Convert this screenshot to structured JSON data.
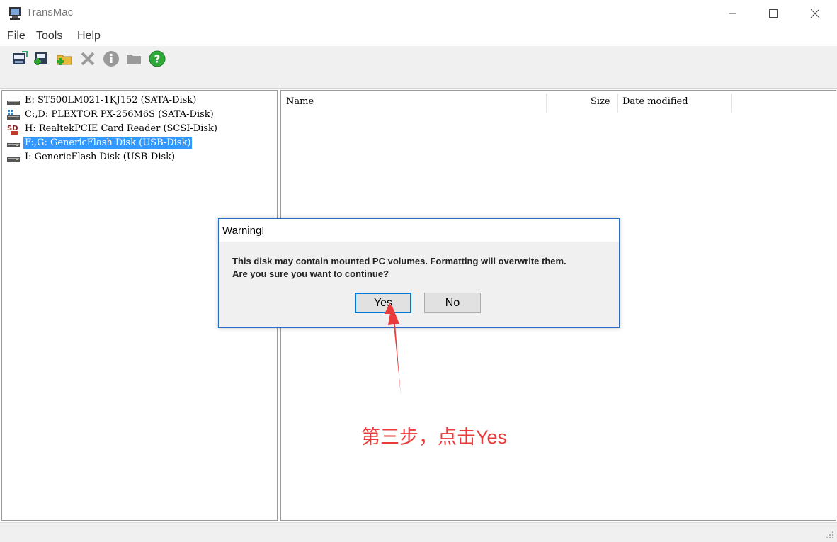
{
  "window": {
    "title": "TransMac",
    "minimize_icon": "minimize-icon",
    "maximize_icon": "maximize-icon",
    "close_icon": "close-icon"
  },
  "menu": {
    "items": [
      {
        "label": "File"
      },
      {
        "label": "Tools"
      },
      {
        "label": "Help"
      }
    ]
  },
  "toolbar": {
    "buttons": [
      {
        "icon": "disk-image-icon"
      },
      {
        "icon": "add-disk-icon"
      },
      {
        "icon": "new-folder-icon"
      },
      {
        "icon": "delete-icon"
      },
      {
        "icon": "info-icon"
      },
      {
        "icon": "folder-icon"
      },
      {
        "icon": "help-icon"
      }
    ]
  },
  "drives": [
    {
      "label": "E: ST500LM021-1KJ152 (SATA-Disk)",
      "icon": "hard-disk-icon",
      "selected": false
    },
    {
      "label": "C:,D: PLEXTOR PX-256M6S (SATA-Disk)",
      "icon": "windows-disk-icon",
      "selected": false
    },
    {
      "label": "H: RealtekPCIE Card Reader (SCSI-Disk)",
      "icon": "sd-card-icon",
      "selected": false
    },
    {
      "label": "F:,G: GenericFlash Disk (USB-Disk)",
      "icon": "hard-disk-icon",
      "selected": true
    },
    {
      "label": "I: GenericFlash Disk (USB-Disk)",
      "icon": "hard-disk-icon",
      "selected": false
    }
  ],
  "file_list": {
    "columns": [
      "Name",
      "Size",
      "Date modified"
    ]
  },
  "dialog": {
    "title": "Warning!",
    "message_line1": "This disk may contain mounted PC volumes. Formatting will overwrite them.",
    "message_line2": "Are you sure you want to continue?",
    "yes_label": "Yes",
    "no_label": "No"
  },
  "annotation": {
    "text": "第三步，点击Yes",
    "color": "#ea3a3a"
  },
  "colors": {
    "selection": "#3399ff",
    "dialog_border": "#2b6cc4",
    "default_button_border": "#0078d7"
  }
}
